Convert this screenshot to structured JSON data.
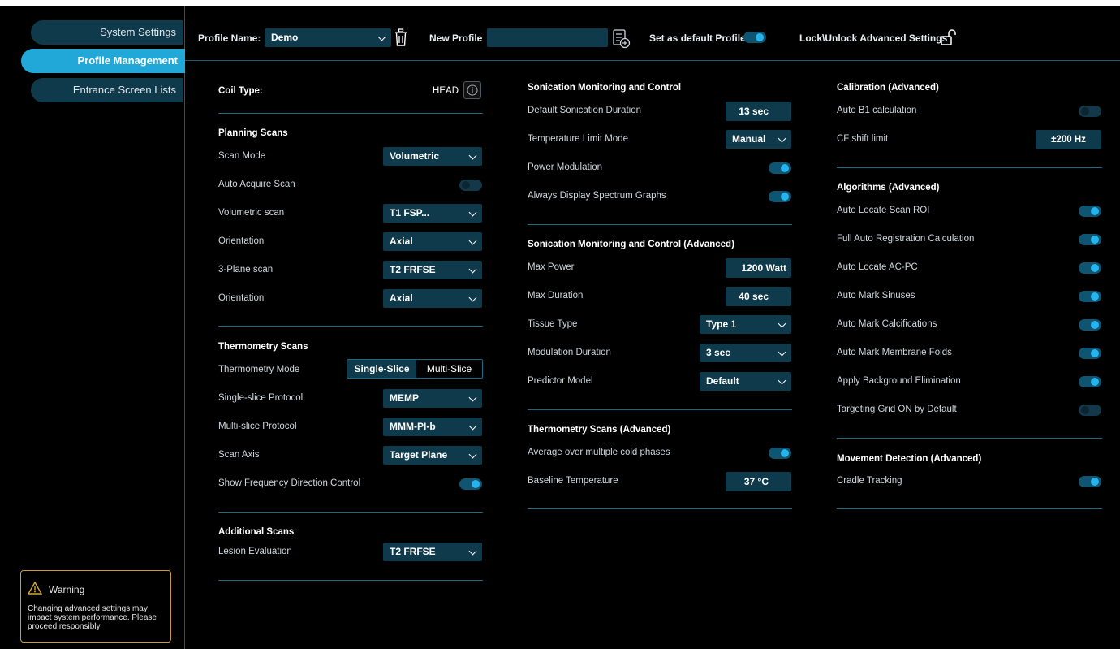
{
  "sidebar": {
    "items": [
      {
        "label": "System Settings",
        "active": false
      },
      {
        "label": "Profile Management",
        "active": true
      },
      {
        "label": "Entrance Screen Lists",
        "active": false
      }
    ],
    "warning": {
      "title": "Warning",
      "text": "Changing advanced settings may impact system performance. Please proceed responsibly"
    }
  },
  "header": {
    "profile_name_label": "Profile Name:",
    "profile_name_value": "Demo",
    "new_profile_label": "New Profile",
    "new_profile_value": "",
    "default_label": "Set as default Profile",
    "default_on": true,
    "lock_label": "Lock\\Unlock Advanced Settings"
  },
  "col1": {
    "coil_type_label": "Coil Type:",
    "coil_type_value": "HEAD",
    "planning": {
      "title": "Planning Scans",
      "scan_mode_label": "Scan Mode",
      "scan_mode_value": "Volumetric",
      "auto_acquire_label": "Auto Acquire Scan",
      "auto_acquire_on": false,
      "volumetric_label": "Volumetric scan",
      "volumetric_value": "T1 FSP...",
      "orientation1_label": "Orientation",
      "orientation1_value": "Axial",
      "three_plane_label": "3-Plane scan",
      "three_plane_value": "T2 FRFSE",
      "orientation2_label": "Orientation",
      "orientation2_value": "Axial"
    },
    "thermometry": {
      "title": "Thermometry Scans",
      "mode_label": "Thermometry Mode",
      "mode_options": [
        "Single-Slice",
        "Multi-Slice"
      ],
      "mode_selected": "Single-Slice",
      "single_label": "Single-slice Protocol",
      "single_value": "MEMP",
      "multi_label": "Multi-slice Protocol",
      "multi_value": "MMM-PI-b",
      "axis_label": "Scan Axis",
      "axis_value": "Target Plane",
      "freq_label": "Show Frequency Direction Control",
      "freq_on": true
    },
    "additional": {
      "title": "Additional Scans",
      "lesion_label": "Lesion Evaluation",
      "lesion_value": "T2 FRFSE"
    }
  },
  "col2": {
    "sonication": {
      "title": "Sonication Monitoring and Control",
      "duration_label": "Default Sonication Duration",
      "duration_value": "13 sec",
      "temp_mode_label": "Temperature Limit Mode",
      "temp_mode_value": "Manual",
      "power_mod_label": "Power Modulation",
      "power_mod_on": true,
      "spectrum_label": "Always Display Spectrum Graphs",
      "spectrum_on": true
    },
    "sonication_adv": {
      "title": "Sonication Monitoring and Control (Advanced)",
      "max_power_label": "Max Power",
      "max_power_value": "1200 Watt",
      "max_duration_label": "Max Duration",
      "max_duration_value": "40 sec",
      "tissue_label": "Tissue Type",
      "tissue_value": "Type 1",
      "mod_dur_label": "Modulation Duration",
      "mod_dur_value": "3 sec",
      "predictor_label": "Predictor Model",
      "predictor_value": "Default"
    },
    "thermo_adv": {
      "title": "Thermometry Scans (Advanced)",
      "avg_label": "Average over multiple  cold phases",
      "avg_on": true,
      "baseline_label": "Baseline Temperature",
      "baseline_value": "37 °C"
    }
  },
  "col3": {
    "calibration": {
      "title": "Calibration (Advanced)",
      "b1_label": "Auto B1 calculation",
      "b1_on": false,
      "cf_label": "CF shift limit",
      "cf_value": "±200 Hz"
    },
    "algorithms": {
      "title": "Algorithms (Advanced)",
      "items": [
        {
          "label": "Auto Locate Scan ROI",
          "on": true
        },
        {
          "label": "Full Auto Registration Calculation",
          "on": true
        },
        {
          "label": "Auto Locate AC-PC",
          "on": true
        },
        {
          "label": "Auto Mark Sinuses",
          "on": true
        },
        {
          "label": "Auto Mark Calcifications",
          "on": true
        },
        {
          "label": "Auto Mark Membrane Folds",
          "on": true
        },
        {
          "label": "Apply Background Elimination",
          "on": true
        },
        {
          "label": "Targeting Grid ON by Default",
          "on": false
        }
      ]
    },
    "movement": {
      "title": "Movement Detection (Advanced)",
      "cradle_label": "Cradle Tracking",
      "cradle_on": true
    }
  },
  "colors": {
    "accent": "#22a8d8",
    "control_bg": "#0f3a4c",
    "divider": "#1d6882",
    "warning_border": "#c8a033"
  }
}
